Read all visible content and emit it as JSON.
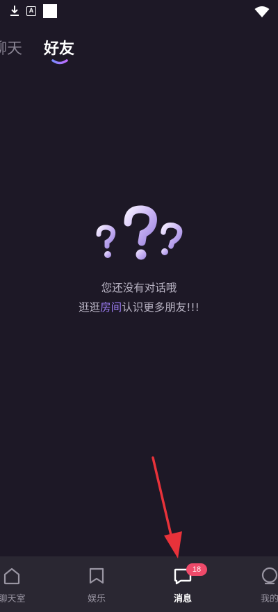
{
  "tabs": {
    "chat_label": "聊天",
    "friends_label": "好友",
    "active_tab": "friends"
  },
  "empty_state": {
    "line1": "您还没有对话哦",
    "line2_prefix": "逛逛",
    "line2_link": "房间",
    "line2_suffix": "认识更多朋友!!!"
  },
  "bottom_nav": {
    "chatroom_label": "聊天室",
    "entertainment_label": "娱乐",
    "messages_label": "消息",
    "messages_badge": "18",
    "mine_label": "我的",
    "active_item": "messages"
  },
  "colors": {
    "background": "#1d1826",
    "nav_background": "#2a2732",
    "accent_purple": "#9c7cf4",
    "badge_red": "#ef4a6a",
    "arrow_red": "#e8323a"
  },
  "icons": {
    "status_left": [
      "download-icon",
      "a-box-icon",
      "white-square-icon"
    ],
    "status_right": "wifi-icon",
    "illustration": "question-marks-icon",
    "nav": [
      "home-icon",
      "bookmark-icon",
      "message-icon",
      "profile-icon"
    ]
  }
}
